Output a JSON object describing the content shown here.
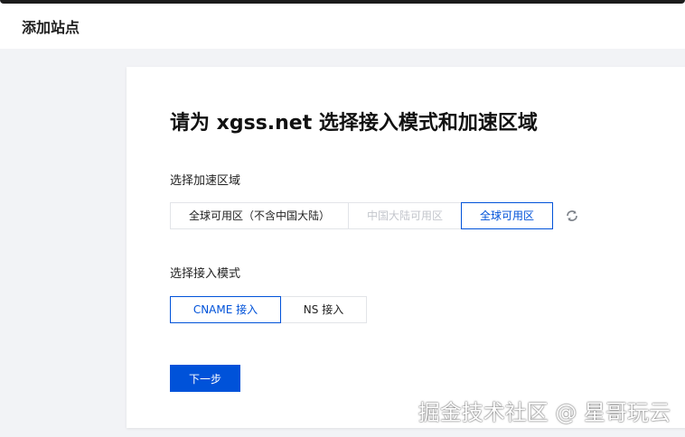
{
  "header": {
    "title": "添加站点"
  },
  "card": {
    "heading": "请为 xgss.net 选择接入模式和加速区域",
    "region": {
      "label": "选择加速区域",
      "options": [
        {
          "label": "全球可用区（不含中国大陆）",
          "state": "normal"
        },
        {
          "label": "中国大陆可用区",
          "state": "disabled"
        },
        {
          "label": "全球可用区",
          "state": "selected"
        }
      ],
      "refresh_icon": "refresh-icon"
    },
    "mode": {
      "label": "选择接入模式",
      "options": [
        {
          "label": "CNAME 接入",
          "state": "selected"
        },
        {
          "label": "NS 接入",
          "state": "normal"
        }
      ]
    },
    "next_label": "下一步"
  },
  "watermark": "掘金技术社区 @ 星哥玩云",
  "colors": {
    "primary": "#0052d9",
    "disabled_text": "#c3c6cc",
    "page_bg": "#f2f3f6"
  }
}
